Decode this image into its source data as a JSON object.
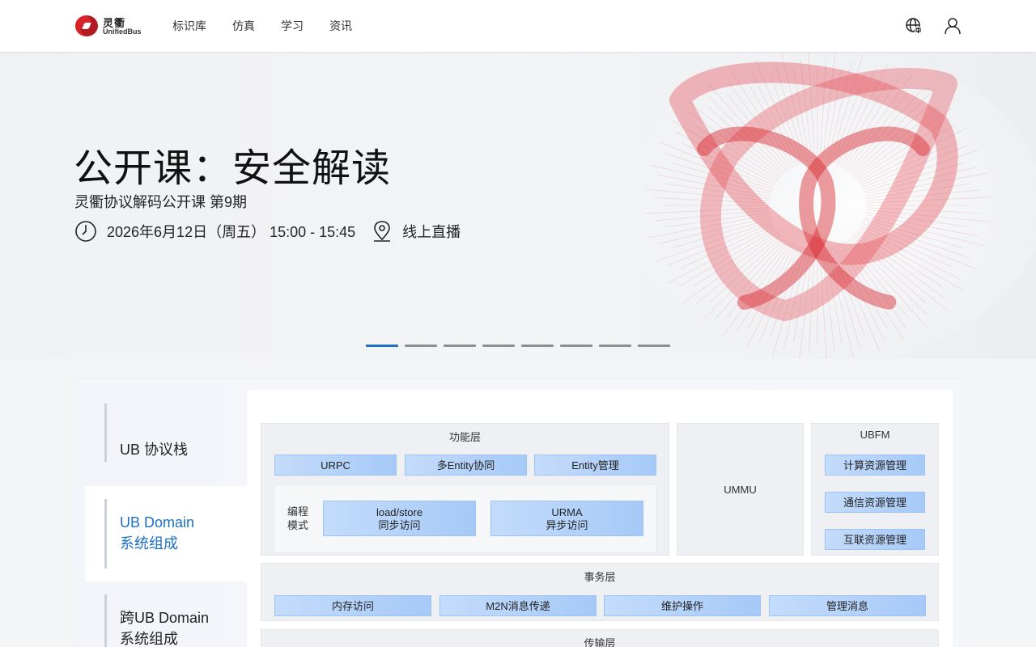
{
  "header": {
    "logo_cn": "灵衢",
    "logo_en": "UnifiedBus",
    "nav": [
      "标识库",
      "仿真",
      "学习",
      "资讯"
    ],
    "colors": {
      "brand_red": "#d8232a",
      "accent_blue": "#1d6fc2"
    }
  },
  "hero": {
    "title": "公开课：安全解读",
    "subtitle": "灵衢协议解码公开课 第9期",
    "datetime": "2026年6月12日（周五） 15:00 - 15:45",
    "location": "线上直播",
    "carousel_total": 8,
    "carousel_active": 1
  },
  "sidebar": {
    "items": [
      {
        "label": "UB 协议栈"
      },
      {
        "label": "UB Domain\n系统组成"
      },
      {
        "label": "跨UB Domain\n系统组成"
      }
    ]
  },
  "diagram": {
    "func_layer": {
      "title": "功能层",
      "pills": [
        "URPC",
        "多Entity协同",
        "Entity管理"
      ],
      "mode_label": "编程\n模式",
      "mode1": "load/store\n同步访问",
      "mode2": "URMA\n异步访问"
    },
    "ummu": "UMMU",
    "ubfm": {
      "title": "UBFM",
      "items": [
        "计算资源管理",
        "通信资源管理",
        "互联资源管理"
      ]
    },
    "tx_layer": {
      "title": "事务层",
      "items": [
        "内存访问",
        "M2N消息传递",
        "维护操作",
        "管理消息"
      ]
    },
    "transport_layer": {
      "title": "传输层"
    }
  }
}
